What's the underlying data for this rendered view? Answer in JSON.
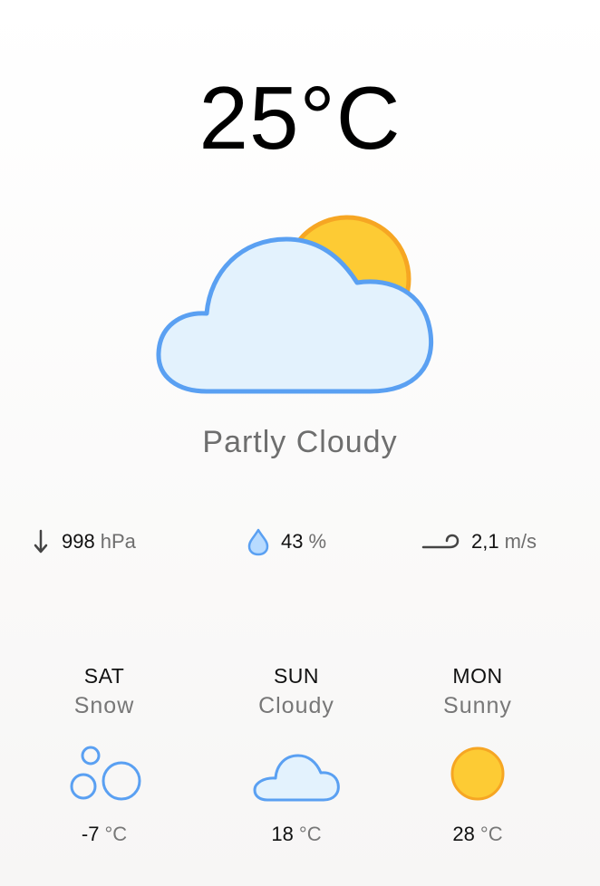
{
  "current": {
    "temperature": "25°C",
    "condition": "Partly Cloudy",
    "icon": "partly-cloudy-icon"
  },
  "stats": {
    "pressure": {
      "value": "998",
      "unit": "hPa",
      "icon": "pressure-arrow-down-icon"
    },
    "humidity": {
      "value": "43",
      "unit": "%",
      "icon": "water-drop-icon"
    },
    "wind": {
      "value": "2,1",
      "unit": "m/s",
      "icon": "wind-icon"
    }
  },
  "forecast": [
    {
      "day": "SAT",
      "condition": "Snow",
      "temp": "-7",
      "unit": "°C",
      "icon": "snow-icon"
    },
    {
      "day": "SUN",
      "condition": "Cloudy",
      "temp": "18",
      "unit": "°C",
      "icon": "cloud-icon"
    },
    {
      "day": "MON",
      "condition": "Sunny",
      "temp": "28",
      "unit": "°C",
      "icon": "sun-icon"
    }
  ],
  "colors": {
    "sun_fill": "#FDCB34",
    "sun_stroke": "#F6A623",
    "cloud_fill": "#E3F2FD",
    "cloud_stroke": "#5AA0F2"
  }
}
